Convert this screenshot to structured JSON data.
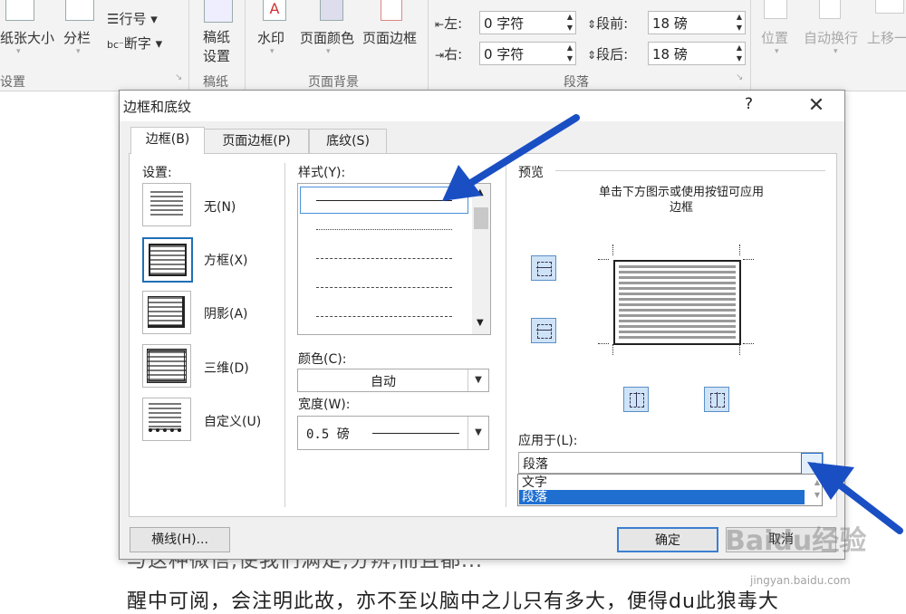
{
  "ribbon": {
    "paper_size": "纸张大小",
    "columns": "分栏",
    "line_numbers": "行号",
    "hyphenation": "断字",
    "group_page_setup": "设置",
    "manuscript": "稿纸\n设置",
    "group_manuscript": "稿纸",
    "watermark": "水印",
    "page_color": "页面颜色",
    "page_borders": "页面边框",
    "group_page_background": "页面背景",
    "indent_left_label": "左:",
    "indent_left_value": "0 字符",
    "indent_right_label": "右:",
    "indent_right_value": "0 字符",
    "spacing_before_label": "段前:",
    "spacing_before_value": "18 磅",
    "spacing_after_label": "段后:",
    "spacing_after_value": "18 磅",
    "group_paragraph": "段落",
    "position": "位置",
    "wrap_text": "自动换行",
    "bring_forward": "上移一"
  },
  "document": {
    "line1": "与这种微信,使我们满足,分辨,而且都...",
    "line2": "醒中可阅，会注明此故，亦不至以脑中之儿只有多大，便得du此狼毒大"
  },
  "dialog": {
    "title": "边框和底纹",
    "help": "?",
    "close": "✕",
    "tabs": [
      "边框(B)",
      "页面边框(P)",
      "底纹(S)"
    ],
    "settings_label": "设置:",
    "settings": [
      "无(N)",
      "方框(X)",
      "阴影(A)",
      "三维(D)",
      "自定义(U)"
    ],
    "style_label": "样式(Y):",
    "color_label": "颜色(C):",
    "color_value": "自动",
    "width_label": "宽度(W):",
    "width_value": "0.5 磅",
    "preview_label": "预览",
    "preview_hint": "单击下方图示或使用按钮可应用\n边框",
    "apply_label": "应用于(L):",
    "apply_value": "段落",
    "apply_options": [
      "文字",
      "段落"
    ],
    "horizontal_line_btn": "横线(H)...",
    "ok_btn": "确定",
    "cancel_btn": "取消"
  },
  "watermark": {
    "text": "Baidu经验",
    "sub": "jingyan.baidu.com"
  },
  "colors": {
    "accent": "#1f6fd1",
    "arrow": "#1a4fc4"
  }
}
